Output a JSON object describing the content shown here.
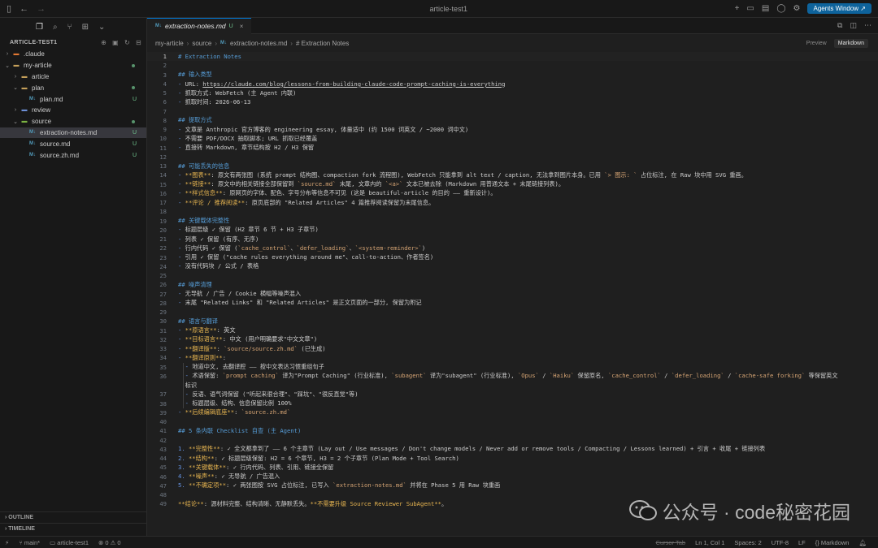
{
  "window": {
    "title": "article-test1",
    "agents_button": "Agents Window ↗"
  },
  "sidebar": {
    "header": "ARTICLE-TEST1",
    "tree": [
      {
        "label": ".claude",
        "indent": 1,
        "kind": "folder-claude",
        "chev": "›",
        "badge": ""
      },
      {
        "label": "my-article",
        "indent": 1,
        "kind": "folder",
        "chev": "⌄",
        "badge": "dot"
      },
      {
        "label": "article",
        "indent": 2,
        "kind": "folder",
        "chev": "›",
        "badge": ""
      },
      {
        "label": "plan",
        "indent": 2,
        "kind": "folder",
        "chev": "⌄",
        "badge": "dot"
      },
      {
        "label": "plan.md",
        "indent": 3,
        "kind": "md",
        "chev": "",
        "badge": "U"
      },
      {
        "label": "review",
        "indent": 2,
        "kind": "folder-review",
        "chev": "›",
        "badge": ""
      },
      {
        "label": "source",
        "indent": 2,
        "kind": "folder-src",
        "chev": "⌄",
        "badge": "dot"
      },
      {
        "label": "extraction-notes.md",
        "indent": 3,
        "kind": "md",
        "chev": "",
        "badge": "U",
        "selected": true
      },
      {
        "label": "source.md",
        "indent": 3,
        "kind": "md",
        "chev": "",
        "badge": "U"
      },
      {
        "label": "source.zh.md",
        "indent": 3,
        "kind": "md",
        "chev": "",
        "badge": "U"
      }
    ],
    "outline": "OUTLINE",
    "timeline": "TIMELINE"
  },
  "editor": {
    "tab": {
      "icon": "M↓",
      "label": "extraction-notes.md",
      "status": "U"
    },
    "breadcrumb": [
      "my-article",
      "source",
      "extraction-notes.md",
      "# Extraction Notes"
    ],
    "view_toggle": [
      "Preview",
      "Markdown"
    ],
    "active_view": "Markdown",
    "lines": [
      {
        "n": "1",
        "t": "# Extraction Notes",
        "c": "h1",
        "cur": true
      },
      {
        "n": "2",
        "t": ""
      },
      {
        "n": "3",
        "t": "## 输入类型",
        "c": "h2"
      },
      {
        "n": "4",
        "t": "- URL: https://claude.com/blog/lessons-from-building-claude-code-prompt-caching-is-everything"
      },
      {
        "n": "5",
        "t": "- 抓取方式: WebFetch (主 Agent 内联)"
      },
      {
        "n": "6",
        "t": "- 抓取时间: 2026-06-13"
      },
      {
        "n": "7",
        "t": ""
      },
      {
        "n": "8",
        "t": "## 提取方式",
        "c": "h2"
      },
      {
        "n": "9",
        "t": "- 文章是 Anthropic 官方博客的 engineering essay, 体量适中 (约 1500 词英文 / ~2000 词中文)"
      },
      {
        "n": "10",
        "t": "- 不需要 PDF/DOCX 抽取脚本; URL 抓取已经覆盖"
      },
      {
        "n": "11",
        "t": "- 直接转 Markdown, 章节结构按 H2 / H3 保留"
      },
      {
        "n": "12",
        "t": ""
      },
      {
        "n": "13",
        "t": "## 可能丢失的信息",
        "c": "h2"
      },
      {
        "n": "14",
        "t": "- **图表**: 原文有两张图 (系统 prompt 结构图、compaction fork 流程图), WebFetch 只能拿到 alt text / caption, 无法拿到图片本身。已用 `> 图示: ` 占位标注, 在 Raw 块中用 SVG 重画。"
      },
      {
        "n": "15",
        "t": "- **链接**: 原文中的相关链接全部保留到 `source.md` 末尾, 文章内的 `<a>` 文本已被去除 (Markdown 用普通文本 + 末尾链接列表)。"
      },
      {
        "n": "16",
        "t": "- **样式信息**: 原网页的字体、配色、字号分布等信息不可见 (这是 beautiful-article 的目的 —— 重新设计)。"
      },
      {
        "n": "17",
        "t": "- **评论 / 推荐阅读**: 原页底部的 \"Related Articles\" 4 篇推荐阅读保留为末尾信息。"
      },
      {
        "n": "18",
        "t": ""
      },
      {
        "n": "19",
        "t": "## 关键载体完整性",
        "c": "h2"
      },
      {
        "n": "20",
        "t": "- 标题层级 ✓ 保留 (H2 章节 6 节 + H3 子章节)"
      },
      {
        "n": "21",
        "t": "- 列表 ✓ 保留 (有序、无序)"
      },
      {
        "n": "22",
        "t": "- 行内代码 ✓ 保留 (`cache_control`、`defer_loading`、`<system-reminder>`)"
      },
      {
        "n": "23",
        "t": "- 引用 ✓ 保留 (\"cache rules everything around me\"、call-to-action、作者签名)"
      },
      {
        "n": "24",
        "t": "- 没有代码块 / 公式 / 表格"
      },
      {
        "n": "25",
        "t": ""
      },
      {
        "n": "26",
        "t": "## 噪声清理",
        "c": "h2"
      },
      {
        "n": "27",
        "t": "- 无导航 / 广告 / Cookie 横幅等噪声混入"
      },
      {
        "n": "28",
        "t": "- 末尾 \"Related Links\" 和 \"Related Articles\" 是正文页面的一部分, 保留为附记"
      },
      {
        "n": "29",
        "t": ""
      },
      {
        "n": "30",
        "t": "## 语言与翻译",
        "c": "h2"
      },
      {
        "n": "31",
        "t": "- **原语言**: 英文"
      },
      {
        "n": "32",
        "t": "- **目标语言**: 中文 (用户明确要求\"中文文章\")"
      },
      {
        "n": "33",
        "t": "- **翻译版**: `source/source.zh.md` (已生成)"
      },
      {
        "n": "34",
        "t": "- **翻译原则**:"
      },
      {
        "n": "35",
        "t": "  - 地道中文, 去翻译腔 —— 按中文表达习惯重组句子",
        "g": true
      },
      {
        "n": "36",
        "t": "  - 术语保留: `prompt caching` 译为\"Prompt Caching\" (行业标准), `subagent` 译为\"subagent\" (行业标准), `Opus` / `Haiku` 保留原名, `cache_control` / `defer_loading` / `cache-safe forking` 等保留英文",
        "g": true
      },
      {
        "n": "",
        "t": "  标识",
        "g": true
      },
      {
        "n": "37",
        "t": "  - 反语、语气词保留 (\"听起来很合理\"、\"踩坑\"、\"很反直觉\"等)",
        "g": true
      },
      {
        "n": "38",
        "t": "  - 标题层级、结构、信息保留比例 100%",
        "g": true
      },
      {
        "n": "39",
        "t": "- **后续编辑底座**: `source.zh.md`"
      },
      {
        "n": "40",
        "t": ""
      },
      {
        "n": "41",
        "t": "## 5 条内联 Checklist 自查 (主 Agent)",
        "c": "h2"
      },
      {
        "n": "42",
        "t": ""
      },
      {
        "n": "43",
        "t": "1. **完整性**: ✓ 全文都拿到了 —— 6 个主章节 (Lay out / Use messages / Don't change models / Never add or remove tools / Compacting / Lessons learned) + 引言 + 收尾 + 链接列表"
      },
      {
        "n": "44",
        "t": "2. **结构**: ✓ 标题层级保留: H2 = 6 个章节, H3 = 2 个子章节 (Plan Mode + Tool Search)"
      },
      {
        "n": "45",
        "t": "3. **关键载体**: ✓ 行内代码、列表、引用、链接全保留"
      },
      {
        "n": "46",
        "t": "4. **噪声**: ✓ 无导航 / 广告混入"
      },
      {
        "n": "47",
        "t": "5. **不确定项**: ✓ 两张图按 SVG 占位标注, 已写入 `extraction-notes.md` 并将在 Phase 5 用 Raw 块重画"
      },
      {
        "n": "48",
        "t": ""
      },
      {
        "n": "49",
        "t": "**结论**: 源材料完整、结构清晰、无静默丢失。**不需要升级 Source Reviewer SubAgent**。"
      }
    ]
  },
  "watermark": {
    "text": "公众号 · code秘密花园"
  },
  "statusbar": {
    "branch": "main*",
    "project": "article-test1",
    "problems": "⊗ 0 ⚠ 0",
    "cursor_tab": "Cursor Tab",
    "position": "Ln 1, Col 1",
    "spaces": "Spaces: 2",
    "encoding": "UTF-8",
    "eol": "LF",
    "language": "{} Markdown"
  },
  "colors": {
    "accent": "#0078d4",
    "untracked": "#73c991",
    "heading": "#569cd6",
    "bold": "#e6b450",
    "code": "#d4a373",
    "link": "#cccccc"
  }
}
